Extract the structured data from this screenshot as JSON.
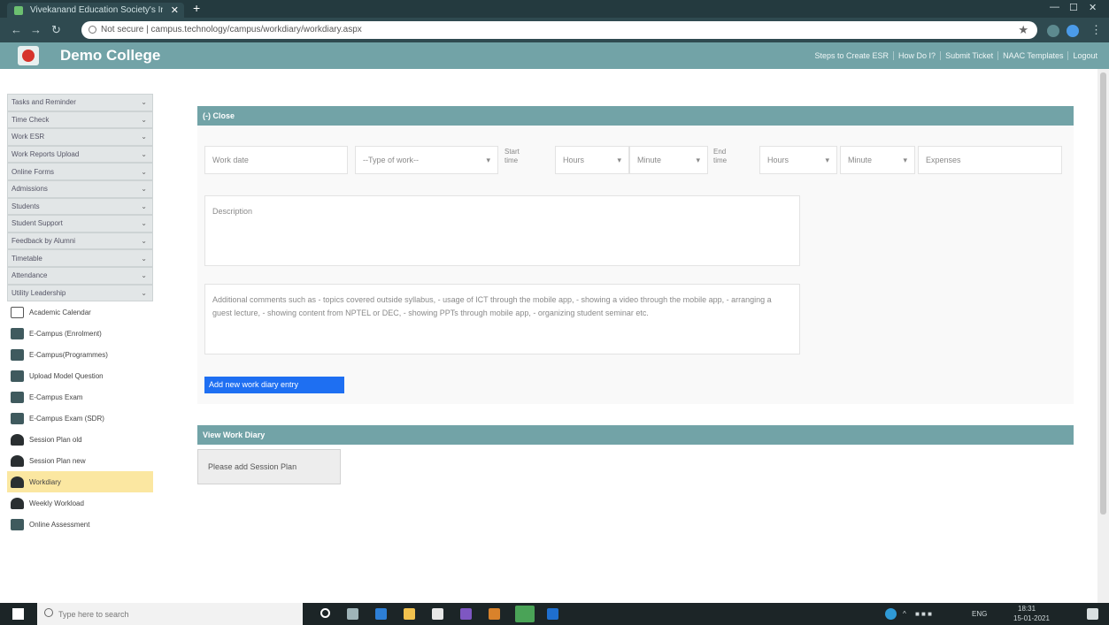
{
  "browser": {
    "tab_title": "Vivekanand Education Society's Institute of Technology",
    "address": "Not secure | campus.technology/campus/workdiary/workdiary.aspx"
  },
  "app": {
    "brand": "Demo College",
    "nav": [
      "Steps to Create ESR",
      "How Do I?",
      "Submit Ticket",
      "NAAC Templates",
      "Logout"
    ]
  },
  "sidebar": {
    "select_items": [
      {
        "label": "Tasks and Reminder"
      },
      {
        "label": "Time Check"
      },
      {
        "label": "Work ESR"
      },
      {
        "label": "Work Reports Upload"
      },
      {
        "label": "Online Forms"
      },
      {
        "label": "Admissions"
      },
      {
        "label": "Students"
      },
      {
        "label": "Student Support"
      },
      {
        "label": "Feedback by Alumni"
      },
      {
        "label": "Timetable"
      },
      {
        "label": "Attendance"
      },
      {
        "label": "Utility Leadership"
      }
    ],
    "link_items": [
      {
        "label": "Academic Calendar",
        "icon": "calendar-icon"
      },
      {
        "label": "E-Campus (Enrolment)",
        "icon": "window-icon"
      },
      {
        "label": "E-Campus(Programmes)",
        "icon": "window-icon"
      },
      {
        "label": "Upload Model Question",
        "icon": "window-icon"
      },
      {
        "label": "E-Campus Exam",
        "icon": "window-icon"
      },
      {
        "label": "E-Campus Exam (SDR)",
        "icon": "window-icon"
      },
      {
        "label": "Session Plan old",
        "icon": "graduation-icon"
      },
      {
        "label": "Session Plan new",
        "icon": "graduation-icon"
      },
      {
        "label": "Workdiary",
        "icon": "graduation-icon",
        "active": true
      },
      {
        "label": "Weekly Workload",
        "icon": "graduation-icon"
      },
      {
        "label": "Online Assessment",
        "icon": "window-icon"
      }
    ]
  },
  "form": {
    "section_title": "(-) Close",
    "work_date_placeholder": "Work date",
    "type_of_work": "--Type of work--",
    "start_time_label": "Start time",
    "hours_label": "Hours",
    "minute_label": "Minute",
    "end_time_label": "End time",
    "expenses_placeholder": "Expenses",
    "description_placeholder": "Description",
    "comments_placeholder": "Additional comments such as - topics covered outside syllabus, - usage of ICT through the mobile app, - showing a video through the mobile app, - arranging a guest lecture, - showing content from NPTEL or DEC, - showing PPTs through mobile app, - organizing student seminar etc.",
    "add_button": "Add new work diary entry"
  },
  "view": {
    "section_title": "View Work Diary",
    "session_button": "Please add Session Plan"
  },
  "taskbar": {
    "search_placeholder": "Type here to search",
    "lang": "ENG",
    "time": "18:31",
    "date": "15-01-2021"
  }
}
